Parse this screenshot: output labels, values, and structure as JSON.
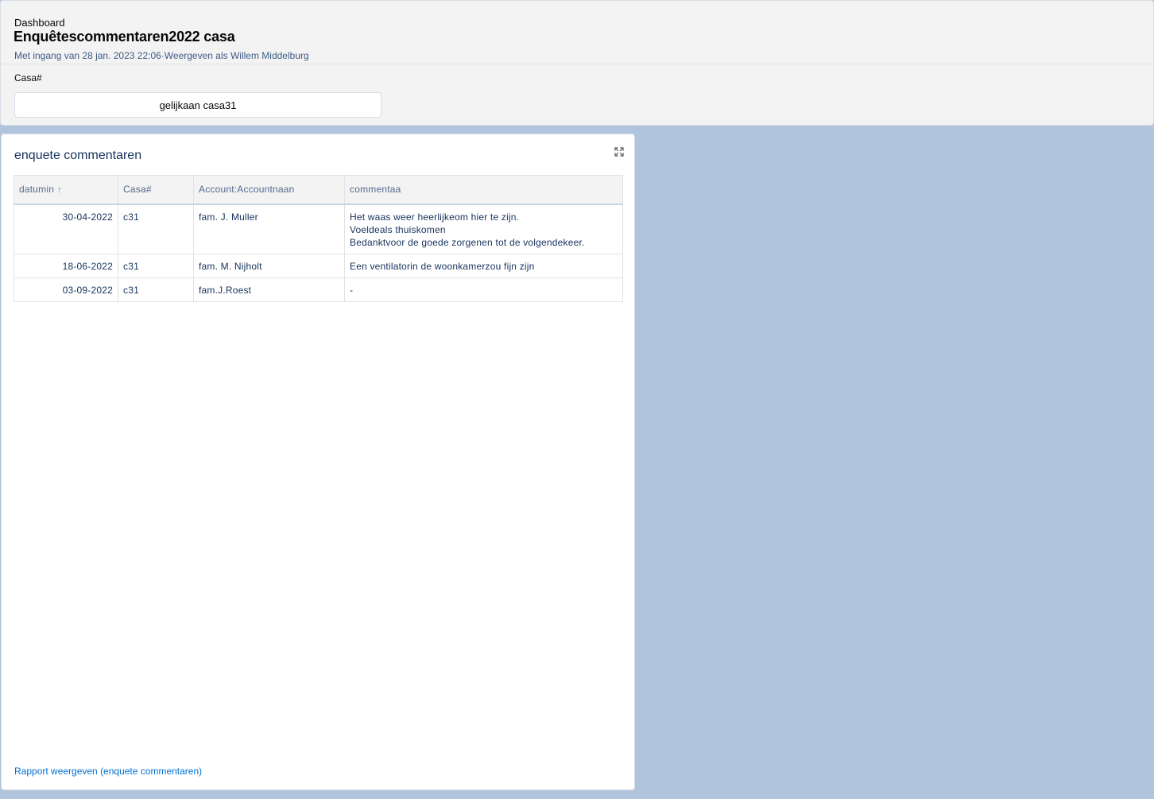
{
  "header": {
    "breadcrumb": "Dashboard",
    "title": "Enquêtescommentaren2022 casa",
    "subtitle": "Met ingang van 28 jan. 2023 22:06·Weergeven als Willem Middelburg",
    "filter": {
      "label": "Casa#",
      "value": "gelijkaan casa31"
    }
  },
  "card": {
    "title": "enquete commentaren",
    "expand_icon": "expand-icon",
    "columns": [
      "datumin",
      "Casa#",
      "Account:Accountnaan",
      "commentaa"
    ],
    "sort_arrow": "↑",
    "rows": [
      {
        "date": "30-04-2022",
        "casa": "c31",
        "account": "fam. J. Muller",
        "comment": [
          "Het waas weer heerlijkeom hier te zijn.",
          "Voeldeals thuiskomen",
          "Bedanktvoor de goede zorgenen tot de volgendekeer."
        ]
      },
      {
        "date": "18-06-2022",
        "casa": "c31",
        "account": "fam. M. Nijholt",
        "comment": [
          "Een ventilatorin de woonkamerzou fijn zijn"
        ]
      },
      {
        "date": "03-09-2022",
        "casa": "c31",
        "account": "fam.J.Roest",
        "comment": [
          "-"
        ]
      }
    ],
    "footer_link": "Rapport weergeven (enquete commentaren)"
  }
}
